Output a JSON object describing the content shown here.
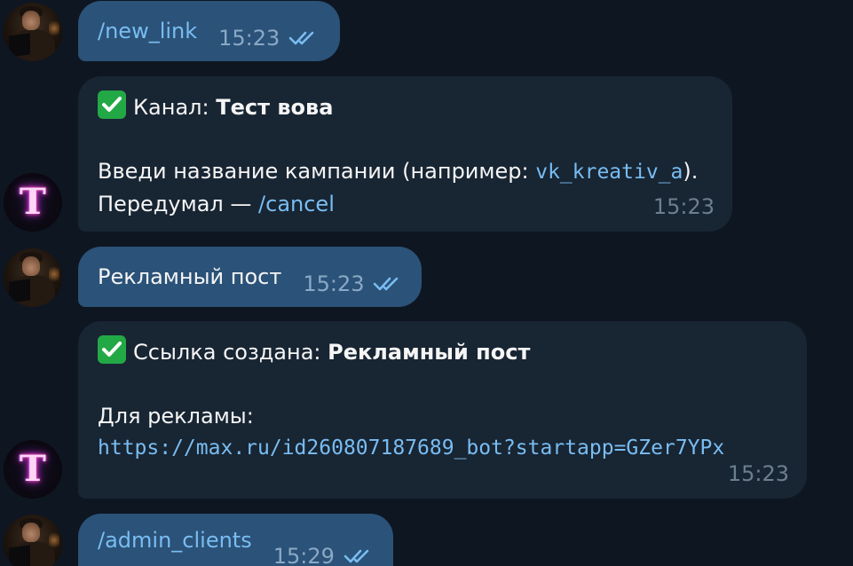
{
  "messages": [
    {
      "type": "outgoing",
      "text": "/new_link",
      "time": "15:23"
    },
    {
      "type": "incoming",
      "status_prefix": "Канал: ",
      "status_value": "Тест вова",
      "prompt_text": "Введи название кампании (например: ",
      "example_code": "vk_kreativ_a",
      "prompt_close": ").",
      "cancel_text": "Передумал — ",
      "cancel_link": "/cancel",
      "time": "15:23"
    },
    {
      "type": "outgoing",
      "text": "Рекламный пост",
      "time": "15:23"
    },
    {
      "type": "incoming",
      "status_prefix": "Ссылка создана: ",
      "status_value": "Рекламный пост",
      "label_text": "Для рекламы:",
      "link_url": "https://max.ru/id260807187689_bot?startapp=GZer7YPx",
      "time": "15:23"
    },
    {
      "type": "outgoing",
      "text": "/admin_clients",
      "time": "15:29"
    }
  ],
  "bot_avatar_letter": "T",
  "colors": {
    "background": "#0e1621",
    "incoming_bubble": "#182533",
    "outgoing_bubble": "#2b5278",
    "link": "#79bdf2",
    "check_badge": "#23a846"
  }
}
